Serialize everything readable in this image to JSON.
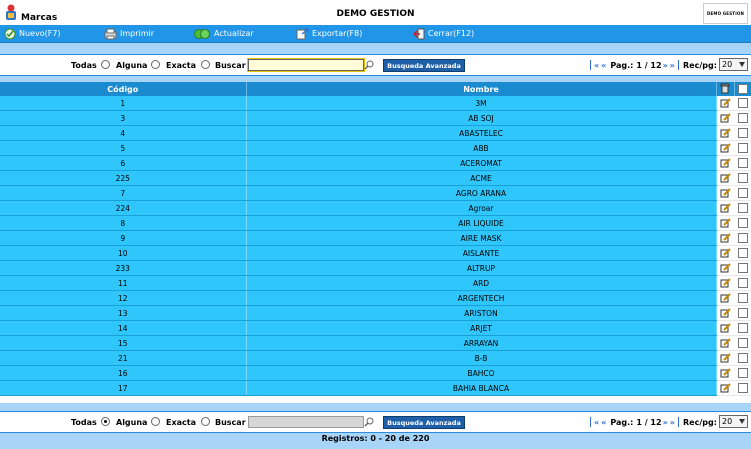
{
  "window": {
    "module_title": "Marcas",
    "app_title": "DEMO GESTION",
    "brand_text": "DEMO GESTION"
  },
  "toolbar": {
    "new_label": "Nuevo(F7)",
    "print_label": "Imprimir",
    "refresh_label": "Actualizar",
    "export_label": "Exportar(F8)",
    "close_label": "Cerrar(F12)"
  },
  "search_top": {
    "opt_all": "Todas",
    "opt_any": "Alguna",
    "opt_exact": "Exacta",
    "search_label": "Buscar",
    "value": "",
    "selected": "exact",
    "advanced_label": "Busqueda Avanzada",
    "page_label": "Pag.:",
    "page_value": "1 / 12",
    "recpg_label": "Rec/pg:",
    "recpg_value": "20"
  },
  "search_bottom": {
    "opt_all": "Todas",
    "opt_any": "Alguna",
    "opt_exact": "Exacta",
    "search_label": "Buscar",
    "value": "",
    "selected": "all",
    "advanced_label": "Busqueda Avanzada",
    "page_label": "Pag.:",
    "page_value": "1 / 12",
    "recpg_label": "Rec/pg:",
    "recpg_value": "20"
  },
  "grid": {
    "col_code": "Código",
    "col_name": "Nombre",
    "rows": [
      {
        "code": "1",
        "name": "3M"
      },
      {
        "code": "3",
        "name": "AB SOJ"
      },
      {
        "code": "4",
        "name": "ABASTELEC"
      },
      {
        "code": "5",
        "name": "ABB"
      },
      {
        "code": "6",
        "name": "ACEROMAT"
      },
      {
        "code": "225",
        "name": "ACME"
      },
      {
        "code": "7",
        "name": "AGRO ARANA"
      },
      {
        "code": "224",
        "name": "Agroar"
      },
      {
        "code": "8",
        "name": "AIR LIQUIDE"
      },
      {
        "code": "9",
        "name": "AIRE MASK"
      },
      {
        "code": "10",
        "name": "AISLANTE"
      },
      {
        "code": "233",
        "name": "ALTRUP"
      },
      {
        "code": "11",
        "name": "ARD"
      },
      {
        "code": "12",
        "name": "ARGENTECH"
      },
      {
        "code": "13",
        "name": "ARISTON"
      },
      {
        "code": "14",
        "name": "ARJET"
      },
      {
        "code": "15",
        "name": "ARRAYAN"
      },
      {
        "code": "21",
        "name": "B-B"
      },
      {
        "code": "16",
        "name": "BAHCO"
      },
      {
        "code": "17",
        "name": "BAHIA BLANCA"
      }
    ]
  },
  "footer": {
    "records_text": "Registros: 0 - 20 de 220"
  },
  "colors": {
    "toolbar_bg": "#2196e8",
    "row_bg": "#2fc6fb",
    "header_bg": "#1b8bd0",
    "page_bg": "#a8d4f7"
  }
}
